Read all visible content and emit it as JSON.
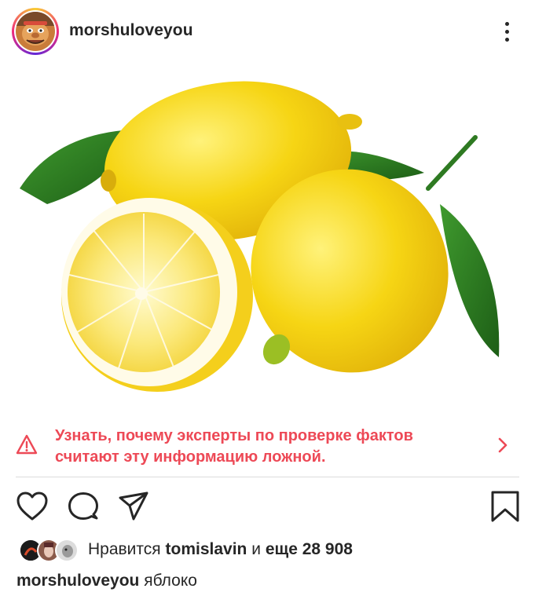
{
  "post": {
    "author": "morshuloveyou",
    "avatar_icon": "morshu-cartoon-avatar",
    "menu_icon": "more-vertical-icon",
    "image_description_icon": "lemons-photo"
  },
  "fact_check": {
    "message": "Узнать, почему эксперты по проверке фактов считают эту информацию ложной.",
    "color": "#ed4956"
  },
  "actions": {
    "like_icon": "heart-icon",
    "comment_icon": "comment-icon",
    "share_icon": "send-icon",
    "save_icon": "bookmark-icon"
  },
  "likes": {
    "prefix": "Нравится",
    "user": "tomislavin",
    "and": "и",
    "count": "еще 28 908"
  },
  "caption": {
    "author": "morshuloveyou",
    "text": "яблоко"
  }
}
